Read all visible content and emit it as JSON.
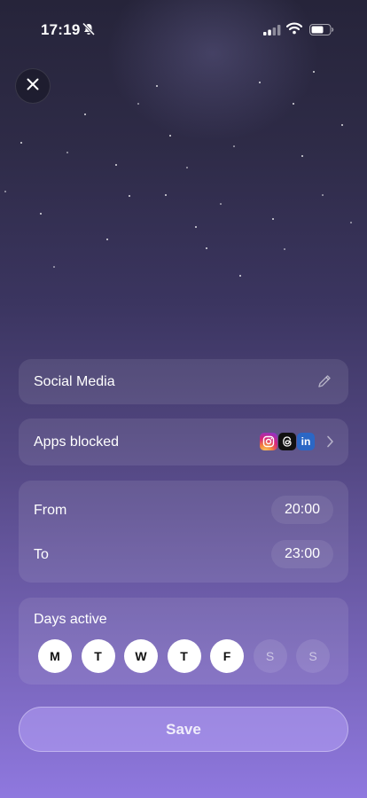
{
  "status_bar": {
    "time": "17:19"
  },
  "icons": {
    "close": "close-icon",
    "edit": "pencil-icon",
    "chevron": "chevron-right-icon"
  },
  "schedule": {
    "name": "Social Media",
    "apps_blocked_label": "Apps blocked",
    "apps": [
      {
        "name": "instagram-icon"
      },
      {
        "name": "threads-icon"
      },
      {
        "name": "linkedin-icon",
        "glyph": "in"
      }
    ],
    "from_label": "From",
    "from_value": "20:00",
    "to_label": "To",
    "to_value": "23:00",
    "days_label": "Days active",
    "days": [
      {
        "label": "M",
        "active": true
      },
      {
        "label": "T",
        "active": true
      },
      {
        "label": "W",
        "active": true
      },
      {
        "label": "T",
        "active": true
      },
      {
        "label": "F",
        "active": true
      },
      {
        "label": "S",
        "active": false
      },
      {
        "label": "S",
        "active": false
      }
    ]
  },
  "save_label": "Save"
}
